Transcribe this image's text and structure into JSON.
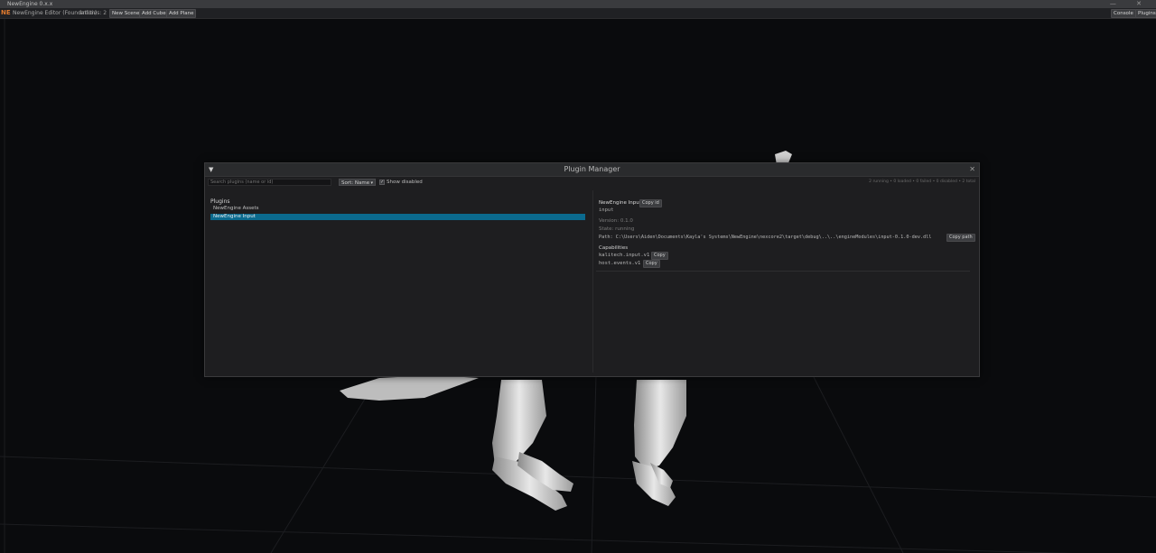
{
  "window": {
    "title": "NewEngine 0.x.x",
    "controls": "— ✕"
  },
  "menubar": {
    "logo_text": "NE",
    "app_name": "NewEngine Editor (Foundation)",
    "entities": "entities: 2",
    "buttons": [
      "New Scene",
      "Add Cube",
      "Add Plane"
    ],
    "right_buttons": [
      "Console",
      "Plugins"
    ]
  },
  "modal": {
    "title": "Plugin Manager",
    "collapse_icon": "▼",
    "close_icon": "✕",
    "search": {
      "placeholder": "Search plugins (name or id)"
    },
    "sort": {
      "value": "Sort: Name",
      "chevron": "▾"
    },
    "show_disabled": {
      "label": "Show disabled",
      "checked": true,
      "check_glyph": "✓"
    },
    "summary": "2 running • 0 loaded • 0 failed • 0 disabled • 2 total",
    "plugins": {
      "header": "Plugins",
      "items": [
        {
          "label": "NewEngine Assets",
          "selected": false
        },
        {
          "label": "NewEngine Input",
          "selected": true
        }
      ]
    },
    "details": {
      "name": "NewEngine Input",
      "copy_id_label": "Copy id",
      "id": "input",
      "version": "Version: 0.1.0",
      "state": "State: running",
      "path": "Path: C:\\Users\\Aiden\\Documents\\Kayla's Systems\\NewEngine\\nexcore2\\target\\debug\\..\\..\\engineModules\\input-0.1.0-dev.dll",
      "copy_path_label": "Copy path",
      "capabilities_header": "Capabilities",
      "capabilities": [
        {
          "name": "kalitech.input.v1",
          "copy_label": "Copy"
        },
        {
          "name": "host.events.v1",
          "copy_label": "Copy"
        }
      ]
    }
  },
  "colors": {
    "accent": "#0b6a8e",
    "logo": "#e07a2e",
    "background": "#0a0b0d"
  }
}
